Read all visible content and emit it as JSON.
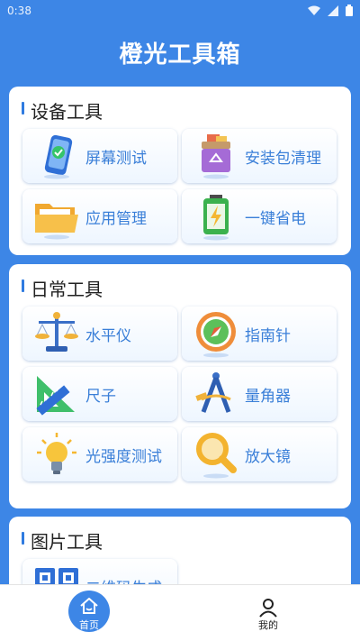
{
  "status": {
    "time": "0:38"
  },
  "app_title": "橙光工具箱",
  "sections": [
    {
      "title": "设备工具",
      "tools": [
        {
          "label": "屏幕测试",
          "icon": "phone-check-icon"
        },
        {
          "label": "安装包清理",
          "icon": "recycle-box-icon"
        },
        {
          "label": "应用管理",
          "icon": "folder-icon"
        },
        {
          "label": "一键省电",
          "icon": "battery-icon"
        }
      ]
    },
    {
      "title": "日常工具",
      "tools": [
        {
          "label": "水平仪",
          "icon": "balance-scale-icon"
        },
        {
          "label": "指南针",
          "icon": "compass-icon"
        },
        {
          "label": "尺子",
          "icon": "ruler-icon"
        },
        {
          "label": "量角器",
          "icon": "divider-tool-icon"
        },
        {
          "label": "光强度测试",
          "icon": "light-bulb-icon"
        },
        {
          "label": "放大镜",
          "icon": "magnifier-icon"
        }
      ]
    },
    {
      "title": "图片工具",
      "tools": [
        {
          "label": "二维码生成",
          "icon": "qr-code-icon"
        }
      ]
    }
  ],
  "bottom_nav": [
    {
      "label": "首页",
      "icon": "home-icon",
      "active": true
    },
    {
      "label": "我的",
      "icon": "user-icon",
      "active": false
    }
  ],
  "colors": {
    "primary": "#3d86e6",
    "tile_text": "#3a7fd8"
  }
}
